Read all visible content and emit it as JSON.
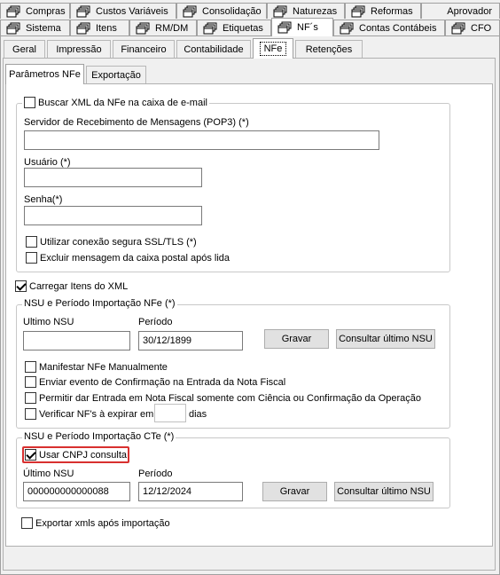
{
  "top_tabs_row1": [
    {
      "label": "Compras",
      "icon": "stack-icon"
    },
    {
      "label": "Custos Variáveis",
      "icon": "stack-icon"
    },
    {
      "label": "Consolidação",
      "icon": "stack-icon"
    },
    {
      "label": "Naturezas",
      "icon": "stack-icon"
    },
    {
      "label": "Reformas",
      "icon": "stack-icon"
    },
    {
      "label": "Aprovador",
      "icon": ""
    }
  ],
  "top_tabs_row2": [
    {
      "label": "Sistema",
      "icon": "stack-icon"
    },
    {
      "label": "Itens",
      "icon": "stack-icon"
    },
    {
      "label": "RM/DM",
      "icon": "stack-icon"
    },
    {
      "label": "Etiquetas",
      "icon": "stack-icon"
    },
    {
      "label": "NF´s",
      "icon": "stack-icon"
    },
    {
      "label": "Contas Contábeis",
      "icon": "stack-icon"
    },
    {
      "label": "CFO",
      "icon": "stack-icon"
    }
  ],
  "sub_tabs": [
    "Geral",
    "Impressão",
    "Financeiro",
    "Contabilidade",
    "NFe",
    "Retenções"
  ],
  "inner_tabs": [
    "Parâmetros NFe",
    "Exportação"
  ],
  "email_group": {
    "title": "Buscar XML da NFe na caixa de e-mail",
    "checked": false,
    "server_label": "Servidor de Recebimento de Mensagens (POP3) (*)",
    "server_value": "",
    "user_label": "Usuário (*)",
    "user_value": "",
    "password_label": "Senha(*)",
    "password_value": "",
    "ssl_label": "Utilizar conexão segura SSL/TLS (*)",
    "ssl_checked": false,
    "delete_label": "Excluir mensagem da caixa postal após lida",
    "delete_checked": false
  },
  "load_items": {
    "label": "Carregar Itens do XML",
    "checked": true
  },
  "nfe_group": {
    "title": "NSU e Período Importação NFe (*)",
    "nsu_label": "Ultimo NSU",
    "nsu_value": "",
    "period_label": "Período",
    "period_value": "30/12/1899",
    "save_label": "Gravar",
    "query_label": "Consultar último NSU",
    "manifest_label": "Manifestar NFe Manualmente",
    "event_label": "Enviar evento de Confirmação na Entrada da Nota Fiscal",
    "allow_label": "Permitir dar Entrada em Nota Fiscal somente com Ciência ou Confirmação da Operação",
    "verify_label": "Verificar NF's à expirar em",
    "verify_value": "",
    "days_label": "dias"
  },
  "cte_group": {
    "title": "NSU e Período Importação CTe (*)",
    "use_cnpj_label": "Usar CNPJ consulta",
    "use_cnpj_checked": true,
    "nsu_label": "Último NSU",
    "nsu_value": "000000000000088",
    "period_label": "Período",
    "period_value": "12/12/2024",
    "save_label": "Gravar",
    "query_label": "Consultar último NSU"
  },
  "export_xml": {
    "label": "Exportar xmls após importação",
    "checked": false
  },
  "colors": {
    "highlight": "#d8302f",
    "panel": "#ffffff",
    "background": "#f0f0f0"
  }
}
